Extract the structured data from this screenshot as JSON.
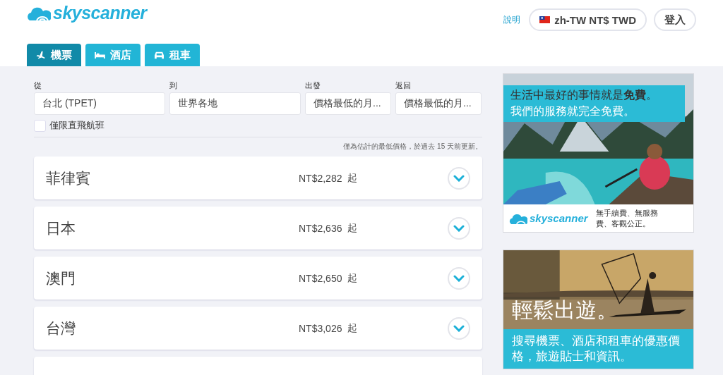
{
  "header": {
    "logo_text": "skyscanner",
    "help": "說明",
    "locale": "zh-TW NT$ TWD",
    "login": "登入"
  },
  "tabs": [
    {
      "label": "機票",
      "kind": "plane",
      "selected": true
    },
    {
      "label": "酒店",
      "kind": "bed",
      "selected": false
    },
    {
      "label": "租車",
      "kind": "car",
      "selected": false
    }
  ],
  "search": {
    "fields": [
      {
        "label": "從",
        "value": "台北 (TPET)"
      },
      {
        "label": "到",
        "value": "世界各地"
      },
      {
        "label": "出發",
        "value": "價格最低的月..."
      },
      {
        "label": "返回",
        "value": "價格最低的月..."
      }
    ],
    "direct_only": {
      "label": "僅限直飛航班",
      "checked": false
    },
    "note": "僅為估計的最低價格，於過去 15 天前更新。"
  },
  "results": [
    {
      "name": "菲律賓",
      "price": "NT$2,282",
      "suffix": "起"
    },
    {
      "name": "日本",
      "price": "NT$2,636",
      "suffix": "起"
    },
    {
      "name": "澳門",
      "price": "NT$2,650",
      "suffix": "起"
    },
    {
      "name": "台灣",
      "price": "NT$3,026",
      "suffix": "起"
    }
  ],
  "ads": [
    {
      "kind": "lake",
      "headline": "生活中最好的事情就是**免費**。",
      "subline": "我們的服務就完全免費。",
      "brand": "skyscanner",
      "tagline": "無手續費、無服務費、客觀公正。"
    },
    {
      "kind": "fisher",
      "headline": "輕鬆出遊。",
      "body": "搜尋機票、酒店和租車的優惠價格，旅遊貼士和資訊。"
    }
  ]
}
